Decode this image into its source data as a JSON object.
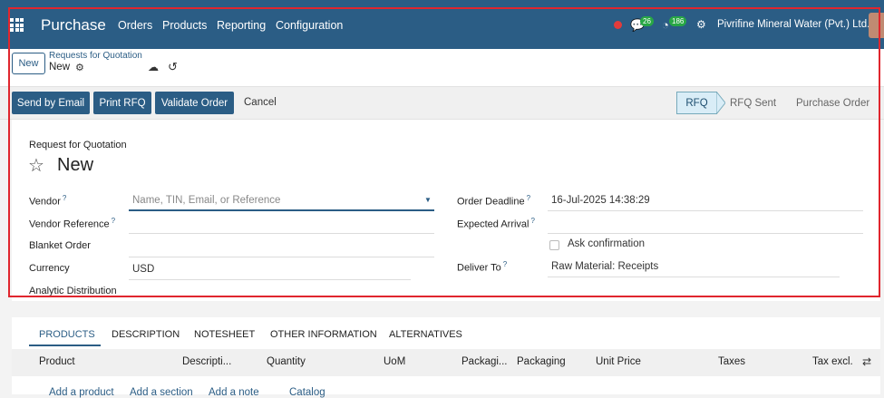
{
  "topbar": {
    "app_name": "Purchase",
    "menu": [
      "Orders",
      "Products",
      "Reporting",
      "Configuration"
    ],
    "messages_count": "26",
    "activities_count": "186",
    "company": "Pivrifine Mineral Water (Pvt.) Ltd."
  },
  "control": {
    "new_label": "New",
    "breadcrumb_parent": "Requests for Quotation",
    "breadcrumb_current": "New"
  },
  "actions": {
    "send_email": "Send by Email",
    "print_rfq": "Print RFQ",
    "validate": "Validate Order",
    "cancel": "Cancel"
  },
  "statusbar": [
    "RFQ",
    "RFQ Sent",
    "Purchase Order"
  ],
  "form": {
    "doc_type": "Request for Quotation",
    "title": "New",
    "vendor_label": "Vendor",
    "vendor_placeholder": "Name, TIN, Email, or Reference",
    "vendor_ref_label": "Vendor Reference",
    "blanket_label": "Blanket Order",
    "currency_label": "Currency",
    "currency_value": "USD",
    "analytic_label": "Analytic Distribution",
    "deadline_label": "Order Deadline",
    "deadline_value": "16-Jul-2025 14:38:29",
    "arrival_label": "Expected Arrival",
    "ask_confirmation_label": "Ask confirmation",
    "deliver_label": "Deliver To",
    "deliver_value": "Raw Material: Receipts",
    "help_mark": "?"
  },
  "tabs": [
    "PRODUCTS",
    "DESCRIPTION",
    "NOTESHEET",
    "OTHER INFORMATION",
    "ALTERNATIVES"
  ],
  "table": {
    "columns": [
      "Product",
      "Descripti...",
      "Quantity",
      "UoM",
      "Packagi...",
      "Packaging",
      "Unit Price",
      "Taxes",
      "Tax excl."
    ],
    "add_links": [
      "Add a product",
      "Add a section",
      "Add a note",
      "Catalog"
    ]
  },
  "colors": {
    "primary": "#2b5d85",
    "highlight_border": "#e0262e"
  }
}
